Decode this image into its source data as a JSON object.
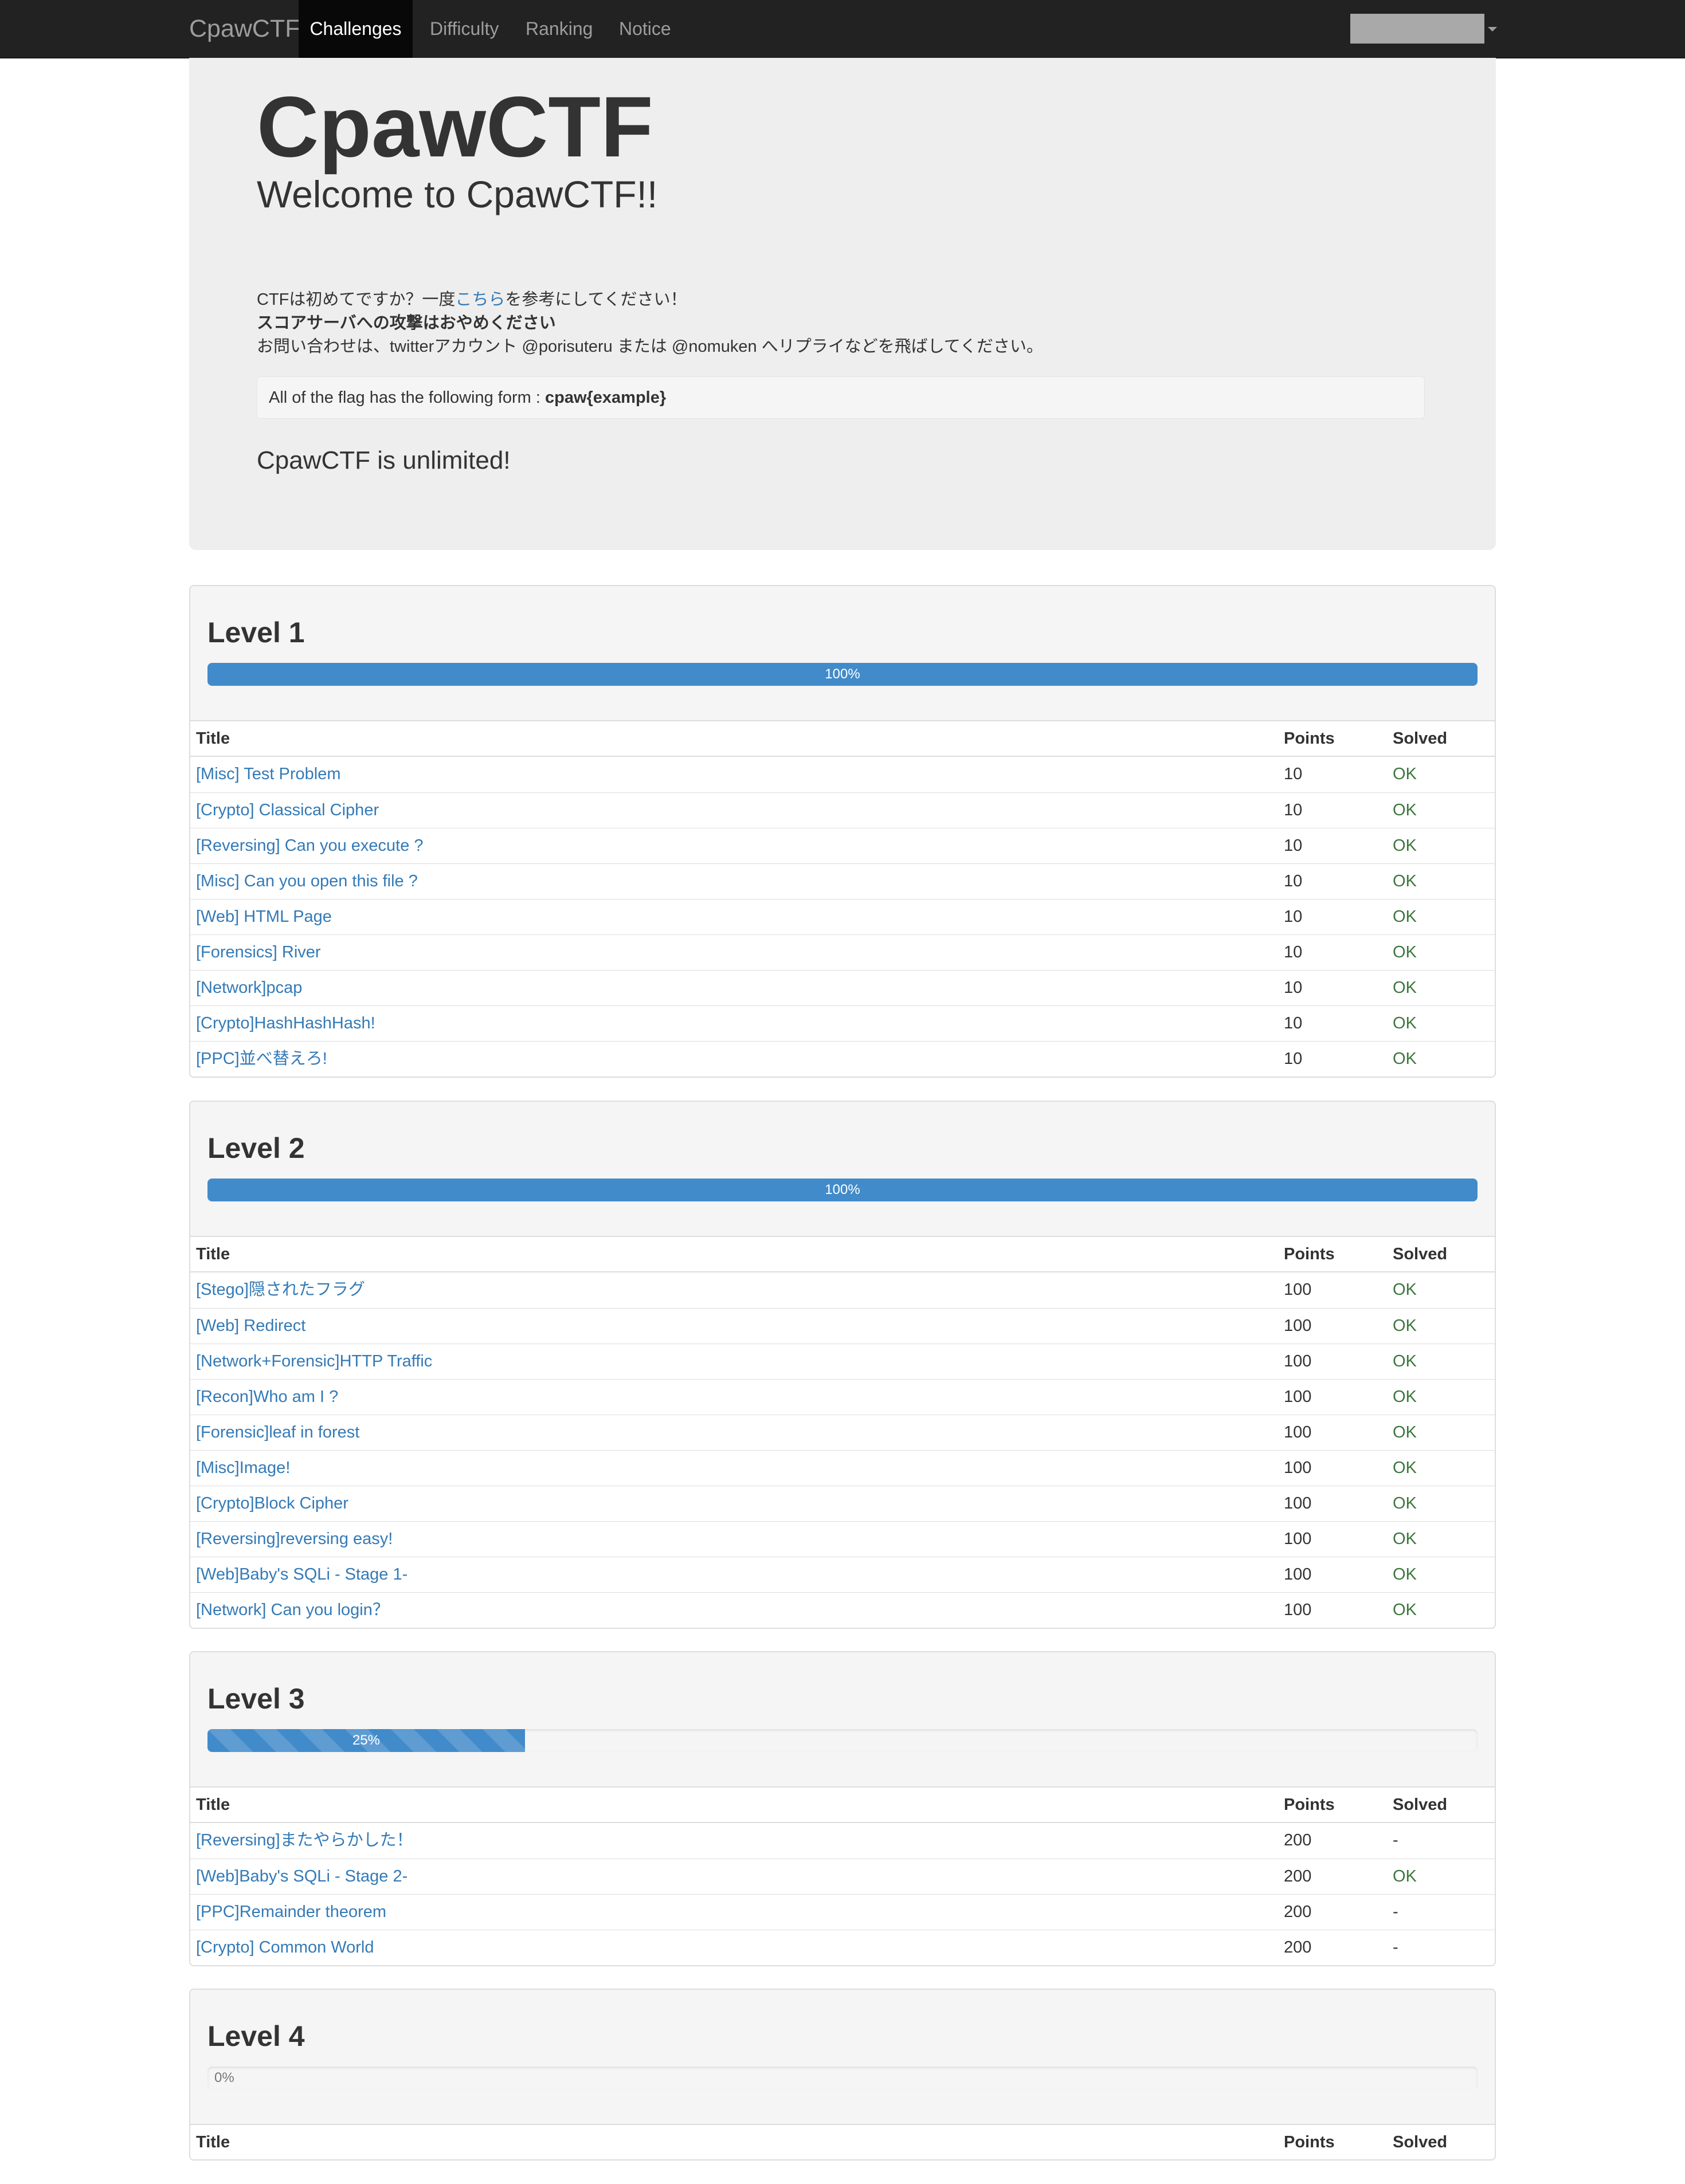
{
  "navbar": {
    "brand": "CpawCTF",
    "items": [
      {
        "label": "Challenges",
        "active": true
      },
      {
        "label": "Difficulty",
        "active": false
      },
      {
        "label": "Ranking",
        "active": false
      },
      {
        "label": "Notice",
        "active": false
      }
    ]
  },
  "jumbotron": {
    "title": "CpawCTF",
    "subtitle": "Welcome to CpawCTF!!",
    "intro_line1_prefix": "CTFは初めてですか？一度",
    "intro_line1_link": "こちら",
    "intro_line1_suffix": "を参考にしてください！",
    "intro_line2": "スコアサーバへの攻撃はおやめください",
    "intro_line3": "お問い合わせは、twitterアカウント @porisuteru または @nomuken へリプライなどを飛ばしてください。",
    "flag_prefix": "All of the flag has the following form : ",
    "flag_format": "cpaw{example}",
    "unlimited": "CpawCTF is unlimited!"
  },
  "table_headers": {
    "title": "Title",
    "points": "Points",
    "solved": "Solved"
  },
  "levels": [
    {
      "title": "Level 1",
      "progress_label": "100%",
      "progress_fraction": 1.0,
      "rows": [
        {
          "title": "[Misc] Test Problem",
          "points": "10",
          "solved": "OK"
        },
        {
          "title": "[Crypto] Classical Cipher",
          "points": "10",
          "solved": "OK"
        },
        {
          "title": "[Reversing] Can you execute ?",
          "points": "10",
          "solved": "OK"
        },
        {
          "title": "[Misc] Can you open this file ?",
          "points": "10",
          "solved": "OK"
        },
        {
          "title": "[Web] HTML Page",
          "points": "10",
          "solved": "OK"
        },
        {
          "title": "[Forensics] River",
          "points": "10",
          "solved": "OK"
        },
        {
          "title": "[Network]pcap",
          "points": "10",
          "solved": "OK"
        },
        {
          "title": "[Crypto]HashHashHash!",
          "points": "10",
          "solved": "OK"
        },
        {
          "title": "[PPC]並べ替えろ!",
          "points": "10",
          "solved": "OK"
        }
      ]
    },
    {
      "title": "Level 2",
      "progress_label": "100%",
      "progress_fraction": 1.0,
      "rows": [
        {
          "title": "[Stego]隠されたフラグ",
          "points": "100",
          "solved": "OK"
        },
        {
          "title": "[Web] Redirect",
          "points": "100",
          "solved": "OK"
        },
        {
          "title": "[Network+Forensic]HTTP Traffic",
          "points": "100",
          "solved": "OK"
        },
        {
          "title": "[Recon]Who am I ?",
          "points": "100",
          "solved": "OK"
        },
        {
          "title": "[Forensic]leaf in forest",
          "points": "100",
          "solved": "OK"
        },
        {
          "title": "[Misc]Image!",
          "points": "100",
          "solved": "OK"
        },
        {
          "title": "[Crypto]Block Cipher",
          "points": "100",
          "solved": "OK"
        },
        {
          "title": "[Reversing]reversing easy!",
          "points": "100",
          "solved": "OK"
        },
        {
          "title": "[Web]Baby's SQLi - Stage 1-",
          "points": "100",
          "solved": "OK"
        },
        {
          "title": "[Network] Can you login？",
          "points": "100",
          "solved": "OK"
        }
      ]
    },
    {
      "title": "Level 3",
      "progress_label": "25%",
      "progress_fraction": 0.25,
      "rows": [
        {
          "title": "[Reversing]またやらかした！",
          "points": "200",
          "solved": "-"
        },
        {
          "title": "[Web]Baby's SQLi - Stage 2-",
          "points": "200",
          "solved": "OK"
        },
        {
          "title": "[PPC]Remainder theorem",
          "points": "200",
          "solved": "-"
        },
        {
          "title": "[Crypto] Common World",
          "points": "200",
          "solved": "-"
        }
      ]
    },
    {
      "title": "Level 4",
      "progress_label": "0%",
      "progress_fraction": 0.0,
      "rows": []
    }
  ]
}
